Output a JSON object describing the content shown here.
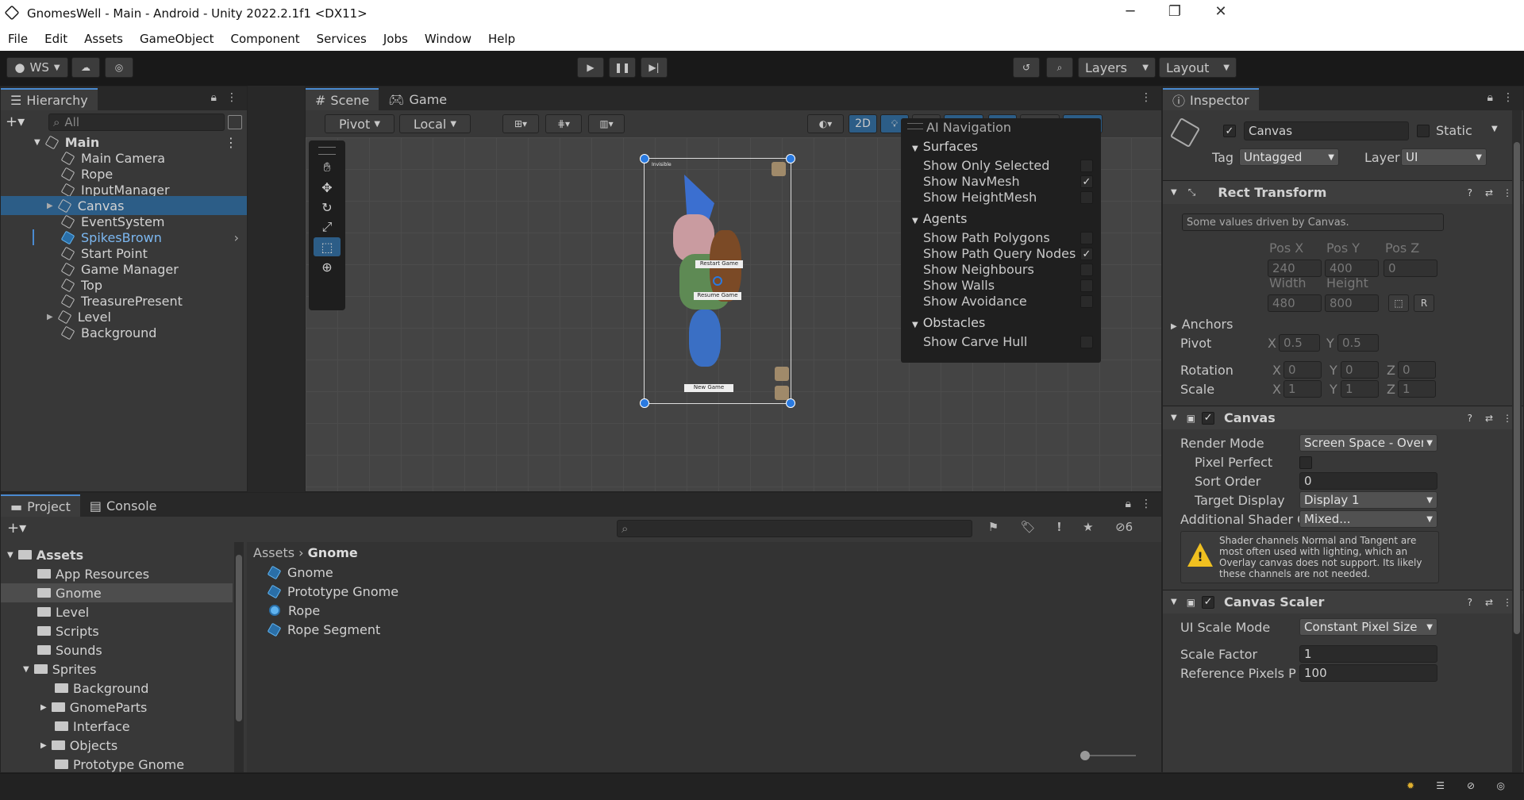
{
  "window": {
    "title": "GnomesWell - Main - Android - Unity 2022.2.1f1 <DX11>",
    "min": "─",
    "max": "❐",
    "close": "✕"
  },
  "menu": [
    "File",
    "Edit",
    "Assets",
    "GameObject",
    "Component",
    "Services",
    "Jobs",
    "Window",
    "Help"
  ],
  "toolbar": {
    "account": "WS",
    "layers": "Layers",
    "layout": "Layout"
  },
  "hierarchy": {
    "tab": "Hierarchy",
    "search_placeholder": "All",
    "root": "Main",
    "items": [
      "Main Camera",
      "Rope",
      "InputManager",
      "Canvas",
      "EventSystem",
      "SpikesBrown",
      "Start Point",
      "Game Manager",
      "Top",
      "TreasurePresent",
      "Level",
      "Background"
    ]
  },
  "scene": {
    "tabs": [
      "Scene",
      "Game"
    ],
    "pivot": "Pivot",
    "local": "Local",
    "mode2d": "2D",
    "canvas_labels": {
      "invisible": "Invisible",
      "restart": "Restart Game",
      "resume": "Resume Game",
      "new_game": "New Game"
    }
  },
  "nav_overlay": {
    "title": "AI Navigation",
    "surfaces": "Surfaces",
    "surface_items": [
      {
        "label": "Show Only Selected",
        "checked": false
      },
      {
        "label": "Show NavMesh",
        "checked": true
      },
      {
        "label": "Show HeightMesh",
        "checked": false
      }
    ],
    "agents": "Agents",
    "agent_items": [
      {
        "label": "Show Path Polygons",
        "checked": false
      },
      {
        "label": "Show Path Query Nodes",
        "checked": true
      },
      {
        "label": "Show Neighbours",
        "checked": false
      },
      {
        "label": "Show Walls",
        "checked": false
      },
      {
        "label": "Show Avoidance",
        "checked": false
      }
    ],
    "obstacles": "Obstacles",
    "obstacle_items": [
      {
        "label": "Show Carve Hull",
        "checked": false
      }
    ]
  },
  "inspector": {
    "tab": "Inspector",
    "name": "Canvas",
    "static": "Static",
    "tag_label": "Tag",
    "tag": "Untagged",
    "layer_label": "Layer",
    "layer": "UI",
    "rect": {
      "title": "Rect Transform",
      "note": "Some values driven by Canvas.",
      "posx_l": "Pos X",
      "posy_l": "Pos Y",
      "posz_l": "Pos Z",
      "posx": "240",
      "posy": "400",
      "posz": "0",
      "width_l": "Width",
      "height_l": "Height",
      "width": "480",
      "height": "800",
      "r": "R",
      "anchors": "Anchors",
      "pivot": "Pivot",
      "pivot_x": "0.5",
      "pivot_y": "0.5",
      "rotation": "Rotation",
      "rot_x": "0",
      "rot_y": "0",
      "rot_z": "0",
      "scale": "Scale",
      "sc_x": "1",
      "sc_y": "1",
      "sc_z": "1",
      "x": "X",
      "y": "Y",
      "z": "Z"
    },
    "canvas": {
      "title": "Canvas",
      "render_mode_l": "Render Mode",
      "render_mode": "Screen Space - Overl",
      "pixel_perfect": "Pixel Perfect",
      "sort_order_l": "Sort Order",
      "sort_order": "0",
      "target_display_l": "Target Display",
      "target_display": "Display 1",
      "shader_l": "Additional Shader Cl",
      "shader": "Mixed...",
      "warning": "Shader channels Normal and Tangent are most often used with lighting, which an Overlay canvas does not support. Its likely these channels are not needed."
    },
    "scaler": {
      "title": "Canvas Scaler",
      "ui_scale_l": "UI Scale Mode",
      "ui_scale": "Constant Pixel Size",
      "scale_factor_l": "Scale Factor",
      "scale_factor": "1",
      "ref_l": "Reference Pixels Per",
      "ref": "100"
    }
  },
  "project": {
    "tabs": [
      "Project",
      "Console"
    ],
    "hidden_count": "6",
    "breadcrumb": [
      "Assets",
      "Gnome"
    ],
    "tree": [
      {
        "label": "Assets",
        "depth": 0,
        "open": true
      },
      {
        "label": "App Resources",
        "depth": 1
      },
      {
        "label": "Gnome",
        "depth": 1,
        "selected": true
      },
      {
        "label": "Level",
        "depth": 1
      },
      {
        "label": "Scripts",
        "depth": 1
      },
      {
        "label": "Sounds",
        "depth": 1
      },
      {
        "label": "Sprites",
        "depth": 1,
        "open": true
      },
      {
        "label": "Background",
        "depth": 2
      },
      {
        "label": "GnomeParts",
        "depth": 2,
        "arrow": true
      },
      {
        "label": "Interface",
        "depth": 2
      },
      {
        "label": "Objects",
        "depth": 2,
        "arrow": true
      },
      {
        "label": "Prototype Gnome",
        "depth": 2
      }
    ],
    "files": [
      "Gnome",
      "Prototype Gnome",
      "Rope",
      "Rope Segment"
    ]
  },
  "colors": {
    "accent": "#4a8ad0",
    "selection": "#2c5d87",
    "prefab_blue": "#7cb7f0"
  }
}
